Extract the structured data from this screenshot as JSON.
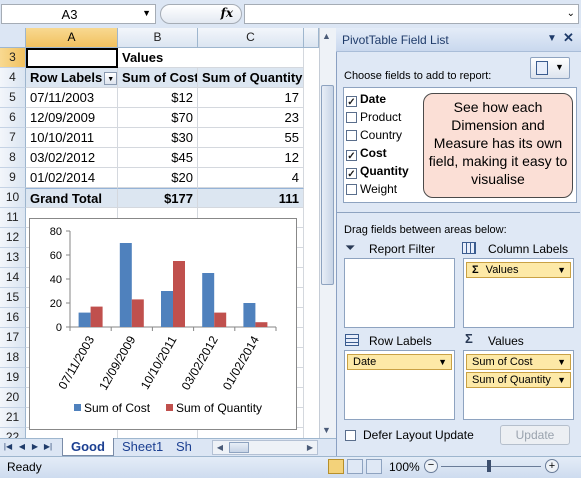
{
  "formula_bar": {
    "name_box": "A3",
    "fx_label": "fx",
    "formula": ""
  },
  "columns": [
    "A",
    "B",
    "C"
  ],
  "rows": [
    "3",
    "4",
    "5",
    "6",
    "7",
    "8",
    "9",
    "10",
    "11",
    "12",
    "13",
    "14",
    "15",
    "16",
    "17",
    "18",
    "19",
    "20",
    "21",
    "22"
  ],
  "pivot": {
    "values_header": "Values",
    "headers": [
      "Row Labels",
      "Sum of Cost",
      "Sum of Quantity"
    ],
    "data": [
      [
        "07/11/2003",
        "$12",
        "17"
      ],
      [
        "12/09/2009",
        "$70",
        "23"
      ],
      [
        "10/10/2011",
        "$30",
        "55"
      ],
      [
        "03/02/2012",
        "$45",
        "12"
      ],
      [
        "01/02/2014",
        "$20",
        "4"
      ]
    ],
    "grand_total": [
      "Grand Total",
      "$177",
      "111"
    ]
  },
  "chart_data": {
    "type": "bar",
    "categories": [
      "07/11/2003",
      "12/09/2009",
      "10/10/2011",
      "03/02/2012",
      "01/02/2014"
    ],
    "series": [
      {
        "name": "Sum of Cost",
        "values": [
          12,
          70,
          30,
          45,
          20
        ],
        "color": "#4f81bd"
      },
      {
        "name": "Sum of Quantity",
        "values": [
          17,
          23,
          55,
          12,
          4
        ],
        "color": "#c0504d"
      }
    ],
    "yticks": [
      "0",
      "20",
      "40",
      "60",
      "80"
    ],
    "ylim": [
      0,
      80
    ],
    "legend": "bottom"
  },
  "sheet_tabs": [
    "Good",
    "Sheet1",
    "Sh"
  ],
  "status": {
    "left": "Ready",
    "zoom": "100%"
  },
  "pane": {
    "title": "PivotTable Field List",
    "choose_label": "Choose fields to add to report:",
    "fields": [
      {
        "label": "Date",
        "checked": true
      },
      {
        "label": "Product",
        "checked": false
      },
      {
        "label": "Country",
        "checked": false
      },
      {
        "label": "Cost",
        "checked": true
      },
      {
        "label": "Quantity",
        "checked": true
      },
      {
        "label": "Weight",
        "checked": false
      }
    ],
    "callout": "See how each Dimension and Measure has its own field, making it easy to visualise",
    "drag_label": "Drag fields between areas below:",
    "report_filter": "Report Filter",
    "column_labels": "Column Labels",
    "row_labels": "Row Labels",
    "values": "Values",
    "column_items": [
      "Values"
    ],
    "row_items": [
      "Date"
    ],
    "value_items": [
      "Sum of Cost",
      "Sum of Quantity"
    ],
    "defer_label": "Defer Layout Update",
    "update_label": "Update"
  }
}
